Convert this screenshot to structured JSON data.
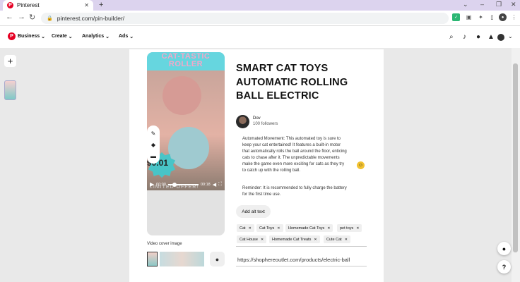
{
  "browser": {
    "tab_title": "Pinterest",
    "new_tab": "+",
    "url": "pinterest.com/pin-builder/",
    "win_controls": [
      "⌄",
      "–",
      "❐",
      "✕"
    ]
  },
  "header": {
    "menus": [
      {
        "label": "Business"
      },
      {
        "label": "Create"
      },
      {
        "label": "Analytics"
      },
      {
        "label": "Ads"
      }
    ]
  },
  "video": {
    "overlay_title": "CAT-TASTIC ROLLER",
    "badge_text": "90.01",
    "offer_text": "LIMITED OFFER!",
    "time_current": "00:00",
    "time_total": "00:18",
    "cover_label": "Video cover image"
  },
  "pin": {
    "title": "SMART CAT TOYS AUTOMATIC ROLLING BALL ELECTRIC",
    "user_name": "Dov",
    "followers": "100 followers",
    "description": "Automated Movement: This automated toy is sure to keep your cat entertained! It features a built-in motor that automatically rolls the ball around the floor, enticing cats to chase after it. The unpredictable movements make the game even more exciting for cats as they try to catch up with the rolling ball.",
    "reminder": "Reminder: It is recommended to fully charge the battery for the first time use.",
    "alt_text_button": "Add alt text",
    "tags": [
      "Cat",
      "Cat Toys",
      "Homemade Cat Toys",
      "pet toys",
      "Cat House",
      "Homemade Cat Treats",
      "Cute Cat"
    ],
    "link": "https://shophereoutlet.com/products/electric-ball"
  },
  "colors": {
    "brand": "#e60023",
    "tab_strip": "#dcd3ee",
    "canvas": "#e9e9e9"
  }
}
